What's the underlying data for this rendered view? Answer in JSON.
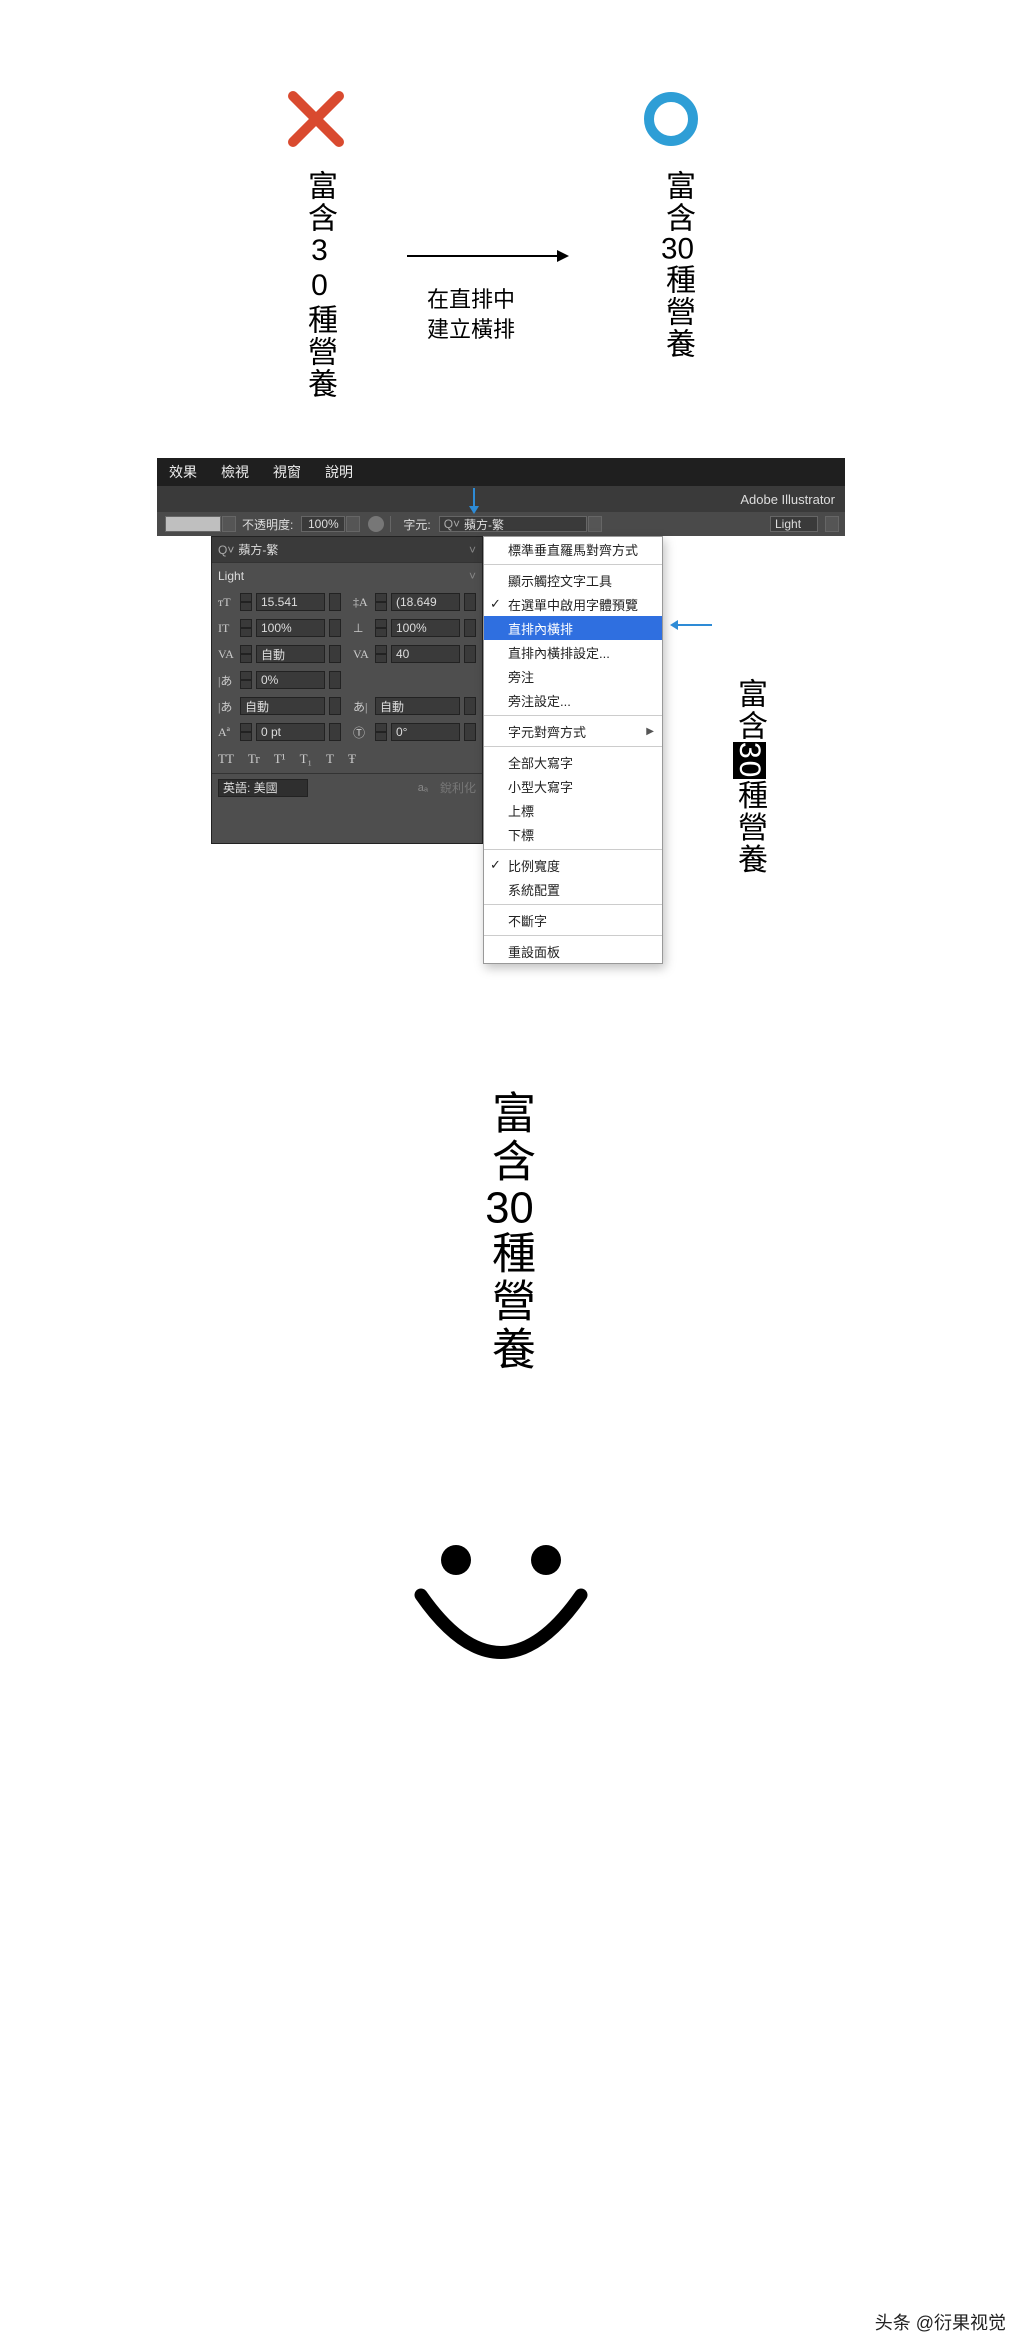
{
  "colors": {
    "red": "#d94a2f",
    "blue": "#2e9ed6",
    "ui_bg": "#4e4e4e",
    "hl": "#2f6fe0"
  },
  "section1": {
    "bad_text": "富含30種營養",
    "good_text_chars": [
      "富",
      "含",
      "30",
      "種",
      "營",
      "養"
    ],
    "caption_l1": "在直排中",
    "caption_l2": "建立橫排"
  },
  "menubar": {
    "items": [
      "效果",
      "檢視",
      "視窗",
      "說明"
    ]
  },
  "app_name": "Adobe Illustrator",
  "control_bar": {
    "opacity_label": "不透明度:",
    "opacity_value": "100%",
    "char_label": "字元:",
    "font_name": "蘋方-繁",
    "font_style": "Light"
  },
  "char_panel": {
    "font_search": "蘋方-繁",
    "font_style": "Light",
    "size": "15.541",
    "leading": "(18.649",
    "vscale": "100%",
    "hscale": "100%",
    "kerning": "自動",
    "tracking": "40",
    "baseline_pct": "0%",
    "tsume": "自動",
    "tsume2": "自動",
    "baseline_shift": "0 pt",
    "rotation": "0°",
    "tt_labels": [
      "TT",
      "Tr",
      "T¹",
      "T₁",
      "T",
      "Ŧ"
    ],
    "language": "英語: 美國",
    "aa_label": "aₐ",
    "sharpen": "銳利化"
  },
  "context_menu": {
    "items": [
      {
        "label": "標準垂直羅馬對齊方式",
        "check": false
      },
      {
        "sep": true
      },
      {
        "label": "顯示觸控文字工具"
      },
      {
        "label": "在選單中啟用字體預覽",
        "check": true
      },
      {
        "label": "直排內橫排",
        "hl": true
      },
      {
        "label": "直排內橫排設定..."
      },
      {
        "label": "旁注"
      },
      {
        "label": "旁注設定..."
      },
      {
        "sep": true
      },
      {
        "label": "字元對齊方式",
        "sub": true
      },
      {
        "sep": true
      },
      {
        "label": "全部大寫字"
      },
      {
        "label": "小型大寫字"
      },
      {
        "label": "上標"
      },
      {
        "label": "下標"
      },
      {
        "sep": true
      },
      {
        "label": "比例寬度",
        "check": true
      },
      {
        "label": "系統配置"
      },
      {
        "sep": true
      },
      {
        "label": "不斷字"
      },
      {
        "sep": true
      },
      {
        "label": "重設面板"
      }
    ]
  },
  "sample2_chars": [
    "富",
    "含",
    "30",
    "種",
    "營",
    "養"
  ],
  "section3": {
    "result_chars": [
      "富",
      "含",
      "30",
      "種",
      "營",
      "養"
    ]
  },
  "credit": "头条 @衍果视觉"
}
